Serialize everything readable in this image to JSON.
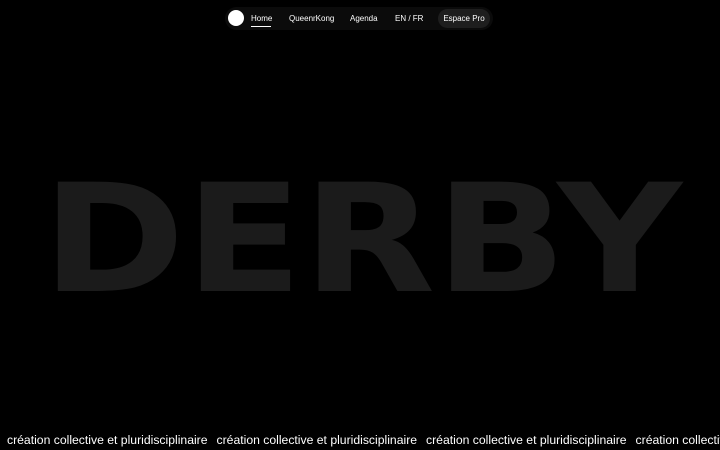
{
  "nav": {
    "items": [
      {
        "label": "Home",
        "active": true
      },
      {
        "label": "QueenrKong"
      },
      {
        "label": "Agenda"
      },
      {
        "label": "EN / FR"
      }
    ],
    "pro_button": "Espace Pro"
  },
  "hero": {
    "title": "DERBY"
  },
  "marquee": {
    "items": [
      "création collective et pluridisciplinaire",
      "création collective et pluridisciplinaire",
      "création collective et pluridisciplinaire",
      "création collective et pluridisciplinaire"
    ]
  },
  "colors": {
    "background": "#000000",
    "hero_text": "#1b1b1b",
    "nav_bg": "#0b0b0b",
    "pro_bg": "#1e1e1e",
    "text": "#ffffff"
  }
}
